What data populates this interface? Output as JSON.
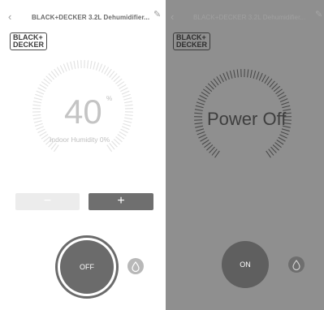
{
  "left": {
    "header": {
      "back_icon": "‹",
      "title": "BLACK+DECKER 3.2L Dehumidifier...",
      "edit_icon": "✎"
    },
    "logo": {
      "line1": "BLACK+",
      "line2": "DECKER"
    },
    "dial": {
      "value": "40",
      "unit": "%",
      "sub_label": "Indoor Humidity 0%"
    },
    "controls": {
      "minus_label": "−",
      "plus_label": "+"
    },
    "power_button": {
      "label": "OFF"
    },
    "mode_icon": "drop-icon",
    "colors": {
      "power": "#6b6b6b",
      "ticks": "#e3e3e3",
      "text": "#c8c8c8"
    }
  },
  "right": {
    "header": {
      "back_icon": "‹",
      "title": "BLACK+DECKER 3.2L Dehumidifier...",
      "edit_icon": "✎"
    },
    "logo": {
      "line1": "BLACK+",
      "line2": "DECKER"
    },
    "status_text": "Power Off",
    "power_button": {
      "label": "ON"
    },
    "mode_icon": "drop-icon",
    "colors": {
      "background": "#8f8f8f",
      "power": "#5f5f5f",
      "ticks": "#4a4a4a"
    }
  }
}
